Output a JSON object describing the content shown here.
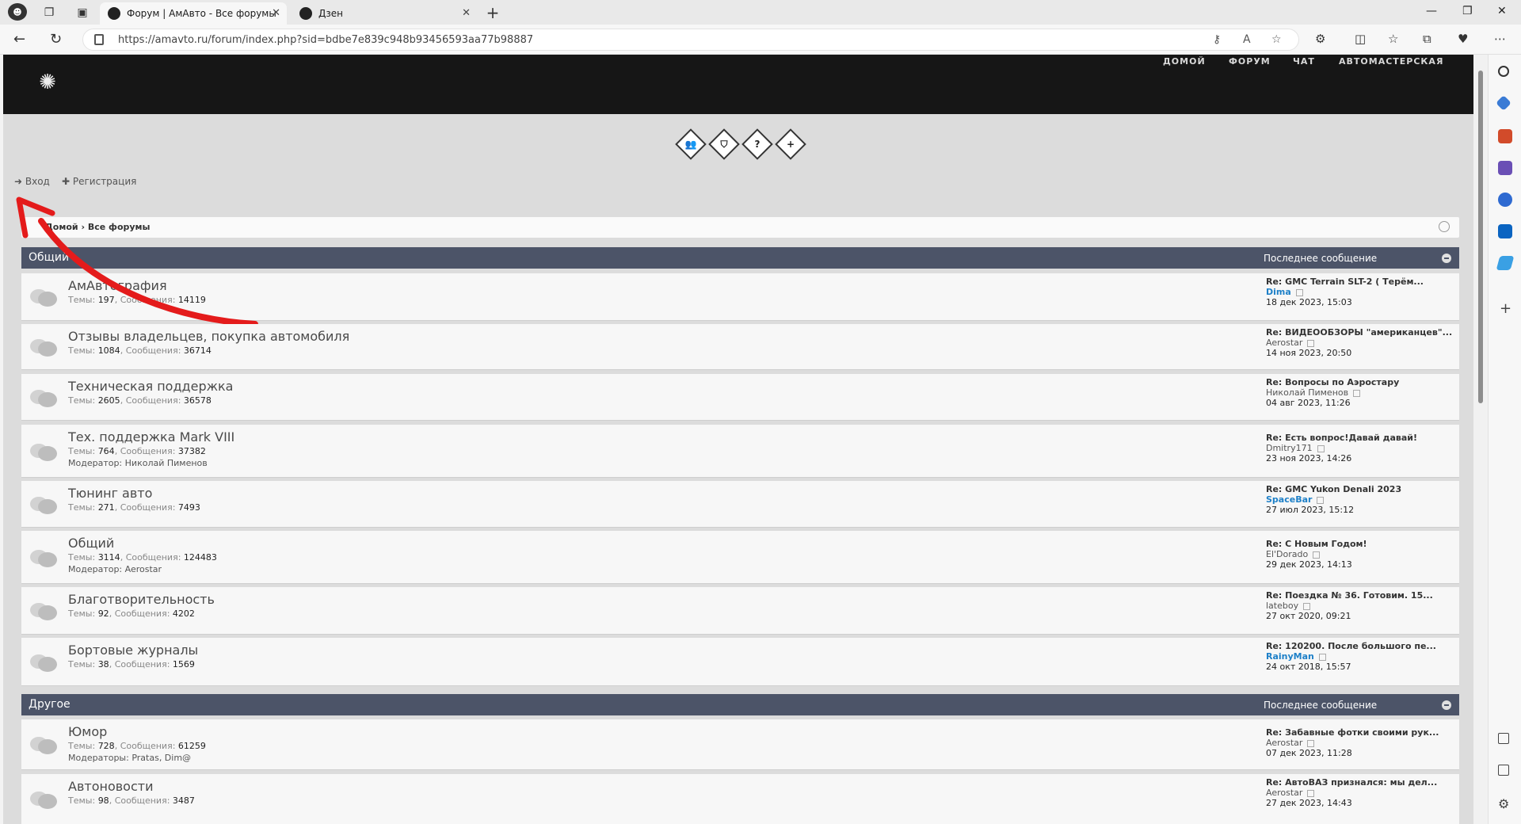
{
  "browser": {
    "tabs": [
      {
        "title": "Форум | АмАвто - Все форумы",
        "active": true
      },
      {
        "title": "Дзен",
        "active": false
      }
    ],
    "url": "https://amavto.ru/forum/index.php?sid=bdbe7e839c948b93456593aa77b98887"
  },
  "site": {
    "nav": [
      "ДОМОЙ",
      "ФОРУМ",
      "ЧАТ",
      "АВТОМАСТЕРСКАЯ"
    ],
    "login": "Вход",
    "register": "Регистрация",
    "breadcrumb_home": "Домой",
    "breadcrumb_current": "Все форумы"
  },
  "categories": [
    {
      "name": "Общий",
      "last_post_label": "Последнее сообщение",
      "forums": [
        {
          "title": "АмАвтография",
          "topics": "197",
          "posts": "14119",
          "moderator_label": "",
          "moderator": "",
          "last_title": "Re: GMC Terrain SLT-2 ( Терём...",
          "last_user": "Dima",
          "last_user_highlight": true,
          "last_date": "18 дек 2023, 15:03"
        },
        {
          "title": "Отзывы владельцев, покупка автомобиля",
          "topics": "1084",
          "posts": "36714",
          "moderator_label": "",
          "moderator": "",
          "last_title": "Re: ВИДЕООБЗОРЫ \"американцев\"...",
          "last_user": "Aerostar",
          "last_user_highlight": false,
          "last_date": "14 ноя 2023, 20:50"
        },
        {
          "title": "Техническая поддержка",
          "topics": "2605",
          "posts": "36578",
          "moderator_label": "",
          "moderator": "",
          "last_title": "Re: Вопросы по Аэростару",
          "last_user": "Николай Пименов",
          "last_user_highlight": false,
          "last_date": "04 авг 2023, 11:26"
        },
        {
          "title": "Тех. поддержка Mark VIII",
          "topics": "764",
          "posts": "37382",
          "moderator_label": "Модератор:",
          "moderator": "Николай Пименов",
          "last_title": "Re: Есть вопрос!Давай давай!",
          "last_user": "Dmitry171",
          "last_user_highlight": false,
          "last_date": "23 ноя 2023, 14:26"
        },
        {
          "title": "Тюнинг авто",
          "topics": "271",
          "posts": "7493",
          "moderator_label": "",
          "moderator": "",
          "last_title": "Re: GMC Yukon Denali 2023",
          "last_user": "SpaceBar",
          "last_user_highlight": true,
          "last_date": "27 июл 2023, 15:12"
        },
        {
          "title": "Общий",
          "topics": "3114",
          "posts": "124483",
          "moderator_label": "Модератор:",
          "moderator": "Aerostar",
          "last_title": "Re: С Новым Годом!",
          "last_user": "El'Dorado",
          "last_user_highlight": false,
          "last_date": "29 дек 2023, 14:13"
        },
        {
          "title": "Благотворительность",
          "topics": "92",
          "posts": "4202",
          "moderator_label": "",
          "moderator": "",
          "last_title": "Re: Поездка № 36. Готовим. 15...",
          "last_user": "lateboy",
          "last_user_highlight": false,
          "last_date": "27 окт 2020, 09:21"
        },
        {
          "title": "Бортовые журналы",
          "topics": "38",
          "posts": "1569",
          "moderator_label": "",
          "moderator": "",
          "last_title": "Re: 120200. После большого пе...",
          "last_user": "RainyMan",
          "last_user_highlight": true,
          "last_date": "24 окт 2018, 15:57"
        }
      ]
    },
    {
      "name": "Другое",
      "last_post_label": "Последнее сообщение",
      "forums": [
        {
          "title": "Юмор",
          "topics": "728",
          "posts": "61259",
          "moderator_label": "Модераторы:",
          "moderator": "Pratas, Dim@",
          "last_title": "Re: Забавные фотки своими рук...",
          "last_user": "Aerostar",
          "last_user_highlight": false,
          "last_date": "07 дек 2023, 11:28"
        },
        {
          "title": "Автоновости",
          "topics": "98",
          "posts": "3487",
          "moderator_label": "",
          "moderator": "",
          "last_title": "Re: АвтоВАЗ признался: мы дел...",
          "last_user": "Aerostar",
          "last_user_highlight": false,
          "last_date": "27 дек 2023, 14:43"
        }
      ]
    }
  ],
  "labels": {
    "topics": "Темы:",
    "posts": "Сообщения:"
  },
  "colors": {
    "header_bg": "#161616",
    "category_bar": "#4c5468",
    "annotation_arrow": "#e41b1b",
    "link_blue": "#1e80c8"
  }
}
